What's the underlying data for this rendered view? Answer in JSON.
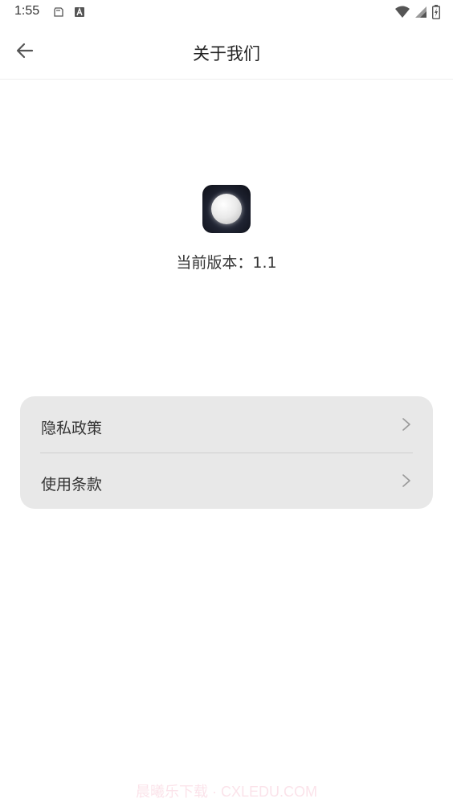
{
  "status_bar": {
    "time": "1:55",
    "left_icons": [
      "clipboard-icon",
      "a-badge-icon"
    ],
    "right_icons": [
      "wifi-icon",
      "cell-signal-icon",
      "battery-charging-icon"
    ]
  },
  "header": {
    "back_icon": "arrow-left-icon",
    "title": "关于我们"
  },
  "app_info": {
    "logo_icon": "moon-app-icon",
    "version_text": "当前版本：1.1"
  },
  "menu": {
    "items": [
      {
        "label": "隐私政策",
        "icon": "chevron-right-icon"
      },
      {
        "label": "使用条款",
        "icon": "chevron-right-icon"
      }
    ]
  },
  "watermark": "晨曦乐下载 · CXLEDU.COM",
  "colors": {
    "background": "#ffffff",
    "card": "#e8e8e8",
    "divider": "#cfcfcf",
    "text": "#222222",
    "chevron": "#999999",
    "watermark": "#fbe3ea"
  }
}
